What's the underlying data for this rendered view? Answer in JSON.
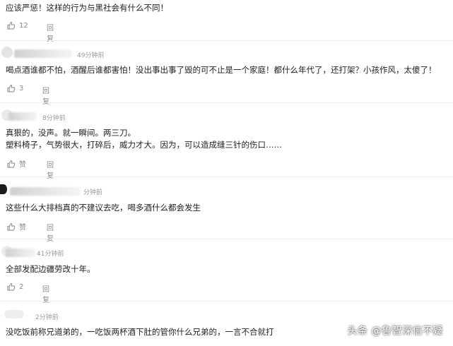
{
  "comments": [
    {
      "text_lines": [
        "应该严惩！这样的行为与黑社会有什么不同！"
      ],
      "time": "",
      "like": "12",
      "reply": "回复"
    },
    {
      "time": "49分钟前",
      "text_lines": [
        "喝点酒谁都不怕，酒醒后谁都害怕！没出事出事了毁的可不止是一个家庭！都什么年代了，还打架？小孩作风，太傻了！"
      ],
      "like": "3",
      "reply": "回复"
    },
    {
      "time": "8分钟前",
      "text_lines": [
        "真狠的，没声。就一瞬间。两三刀。",
        "塑料椅子，气势很大，打碎后，威力才大。因为，可以造成缝三针的伤口……"
      ],
      "like": "赞",
      "reply": "回复"
    },
    {
      "time": "分钟前",
      "text_lines": [
        "这些什么大排档真的不建议去吃，喝多酒什么都会发生"
      ],
      "like": "赞",
      "reply": "回复"
    },
    {
      "time": "41分钟前",
      "text_lines": [
        "全部发配边疆劳改十年。"
      ],
      "like": "2",
      "reply": "回复"
    },
    {
      "time": "2分钟前",
      "text_lines": [
        "没吃饭前称兄道弟的，一吃饭两杯酒下肚的管你什么兄弟的，一言不合就打"
      ],
      "like": "",
      "reply": ""
    }
  ],
  "watermark": "头条 @鲁智深信不疑"
}
